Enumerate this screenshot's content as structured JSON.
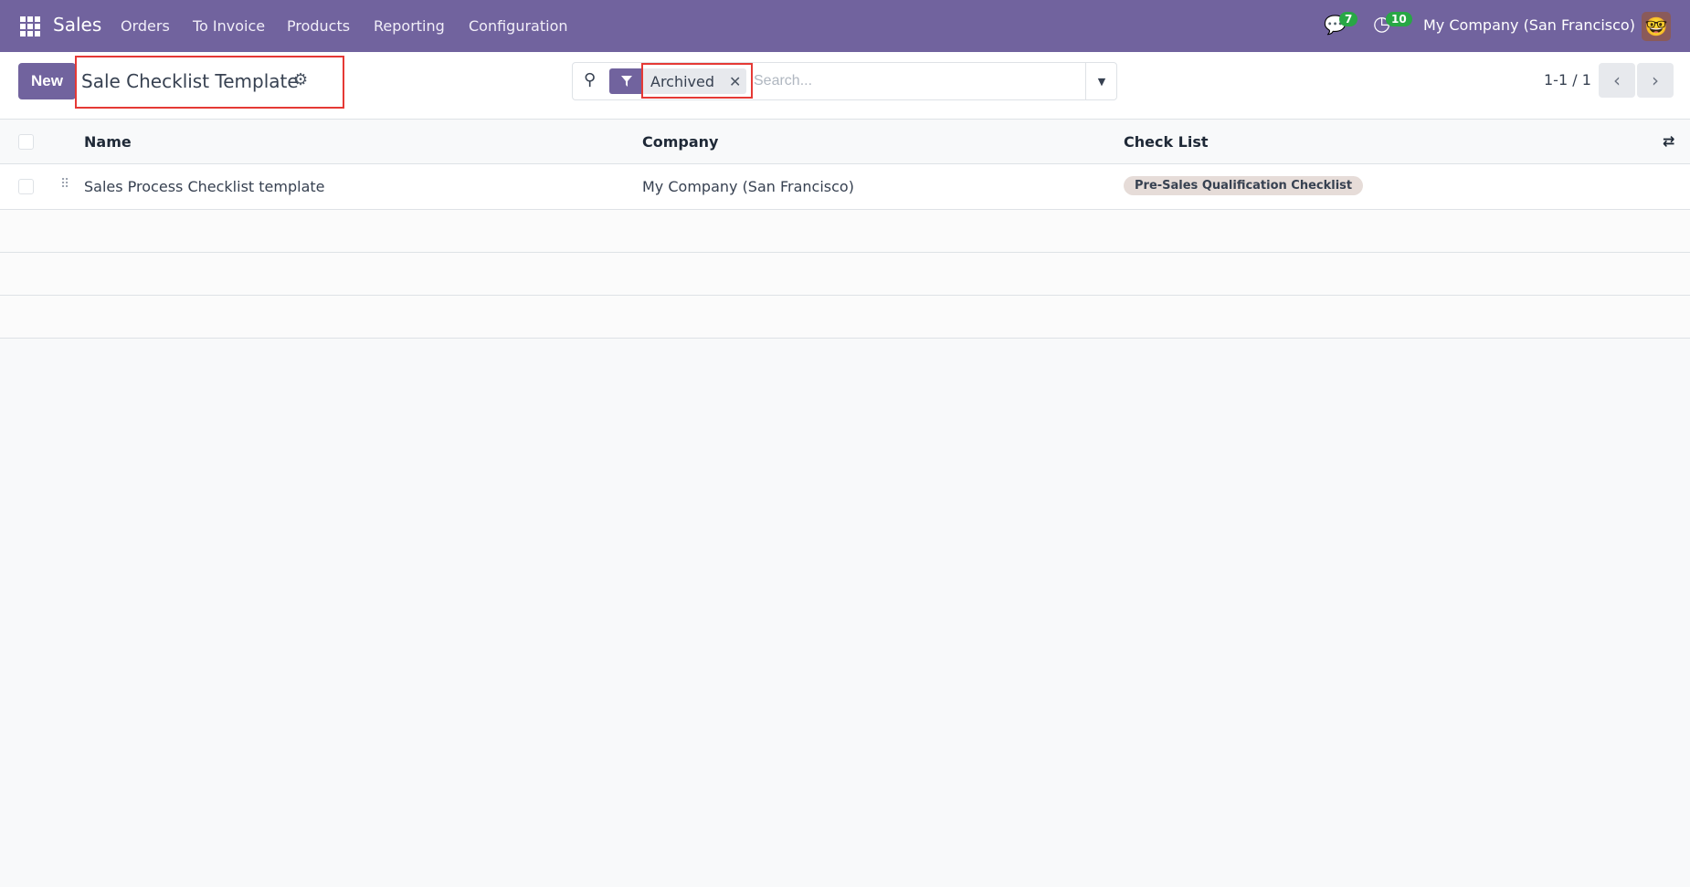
{
  "navbar": {
    "app": "Sales",
    "menu": [
      "Orders",
      "To Invoice",
      "Products",
      "Reporting",
      "Configuration"
    ],
    "messages_badge": "7",
    "activities_badge": "10",
    "company": "My Company (San Francisco)"
  },
  "control_panel": {
    "new_label": "New",
    "title": "Sale Checklist Template",
    "facet": "Archived",
    "search_placeholder": "Search...",
    "pager": "1-1 / 1"
  },
  "table": {
    "headers": [
      "Name",
      "Company",
      "Check List"
    ],
    "rows": [
      {
        "name": "Sales Process Checklist template",
        "company": "My Company (San Francisco)",
        "check_list": "Pre-Sales Qualification Checklist"
      }
    ]
  },
  "colors": {
    "brand": "#71639e",
    "badge": "#28a745",
    "highlight": "#e53935"
  }
}
